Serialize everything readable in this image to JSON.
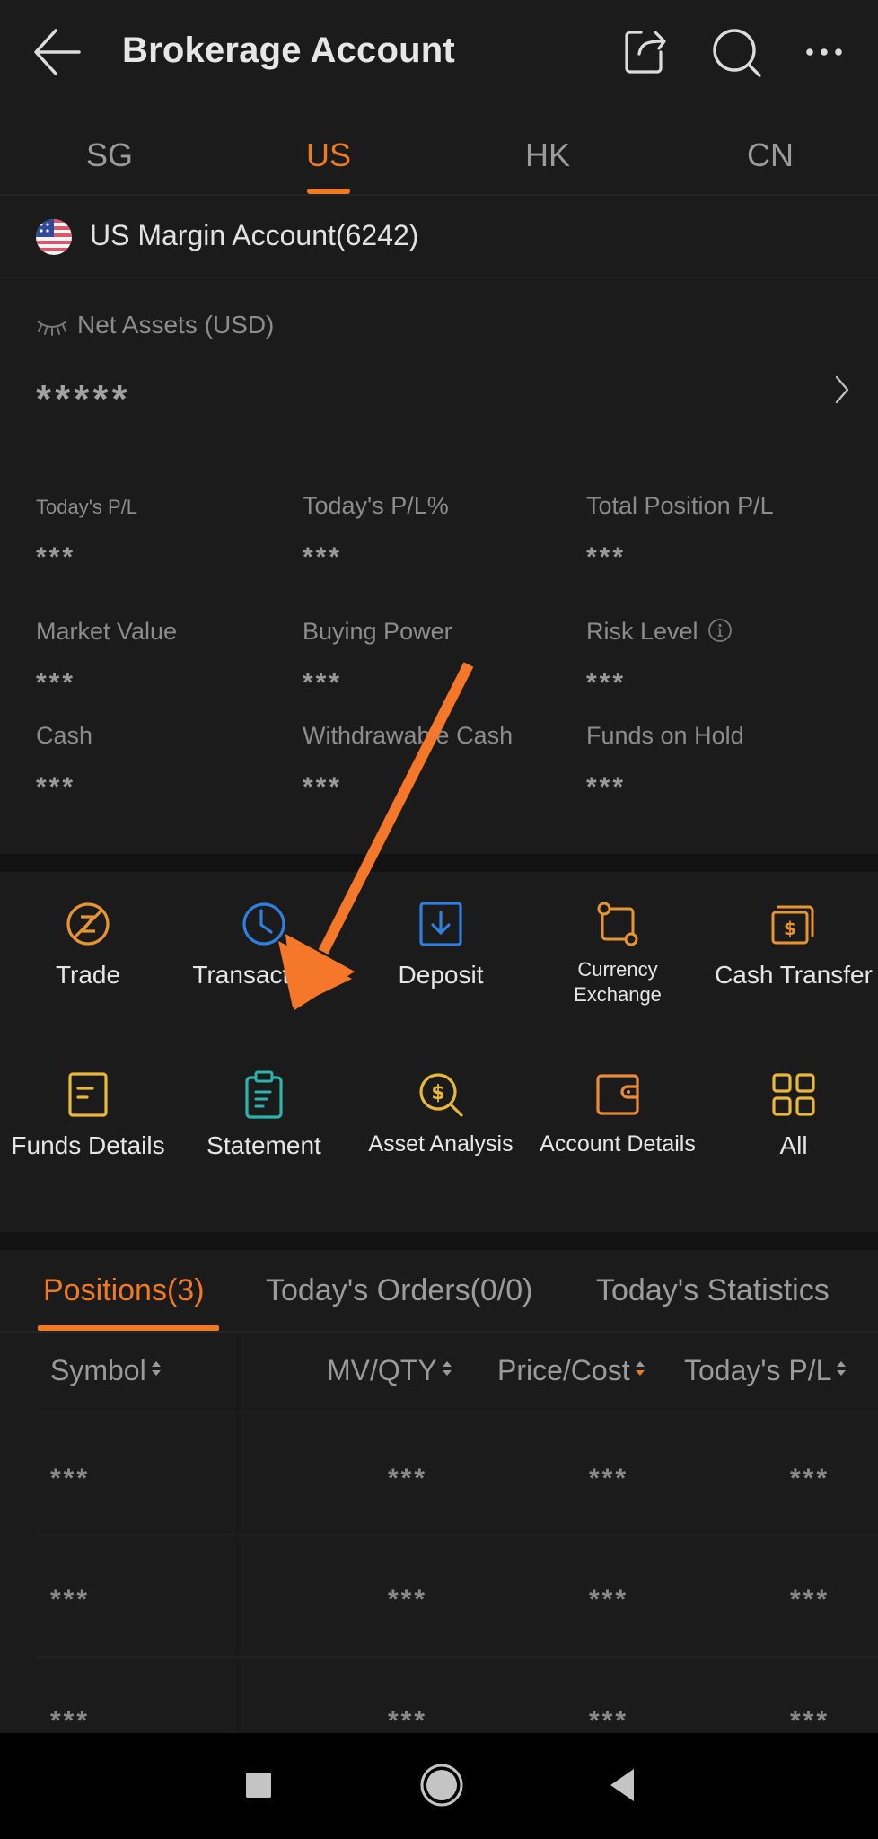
{
  "header": {
    "title": "Brokerage Account",
    "icons": [
      "back-arrow-icon",
      "share-icon",
      "search-icon",
      "more-icon"
    ]
  },
  "market_tabs": [
    {
      "label": "SG",
      "active": false
    },
    {
      "label": "US",
      "active": true
    },
    {
      "label": "HK",
      "active": false
    },
    {
      "label": "CN",
      "active": false
    }
  ],
  "account": {
    "name": "US Margin Account(6242)",
    "flag": "us-flag-icon"
  },
  "net_assets": {
    "label": "Net Assets (USD)",
    "value": "*****",
    "visibility_icon": "eye-closed-icon"
  },
  "metrics": [
    {
      "label": "Today's P/L",
      "value": "***"
    },
    {
      "label": "Today's P/L%",
      "value": "***"
    },
    {
      "label": "Total Position P/L",
      "value": "***"
    },
    {
      "label": "Market Value",
      "value": "***"
    },
    {
      "label": "Buying Power",
      "value": "***"
    },
    {
      "label": "Risk Level",
      "value": "***"
    },
    {
      "label": "Cash",
      "value": "***"
    },
    {
      "label": "Withdrawable Cash",
      "value": "***"
    },
    {
      "label": "Funds on Hold",
      "value": "***"
    }
  ],
  "shortcuts": [
    {
      "label": "Trade",
      "icon": "trade-icon"
    },
    {
      "label": "Transactions",
      "icon": "clock-icon"
    },
    {
      "label": "Deposit",
      "icon": "deposit-icon"
    },
    {
      "label": "Currency Exchange",
      "icon": "currency-exchange-icon"
    },
    {
      "label": "Cash Transfer",
      "icon": "cash-transfer-icon"
    },
    {
      "label": "Funds Details",
      "icon": "funds-details-icon"
    },
    {
      "label": "Statement",
      "icon": "statement-icon"
    },
    {
      "label": "Asset Analysis",
      "icon": "asset-analysis-icon"
    },
    {
      "label": "Account Details",
      "icon": "wallet-icon"
    },
    {
      "label": "All",
      "icon": "grid-icon"
    }
  ],
  "colors": {
    "accent": "#f07a23",
    "background": "#1b1b1b",
    "icon_orange": "#e8952f",
    "icon_blue": "#2e7fe0",
    "icon_teal": "#2bb3ad",
    "icon_yellow": "#e9b83a"
  },
  "position_tabs": [
    {
      "label": "Positions(3)",
      "active": true
    },
    {
      "label": "Today's Orders(0/0)",
      "active": false
    },
    {
      "label": "Today's Statistics",
      "active": false
    }
  ],
  "table": {
    "columns": [
      {
        "label": "Symbol",
        "sort": "none"
      },
      {
        "label": "MV/QTY",
        "sort": "none"
      },
      {
        "label": "Price/Cost",
        "sort": "descending"
      },
      {
        "label": "Today's P/L",
        "sort": "none"
      }
    ],
    "rows": [
      [
        "***",
        "***",
        "***",
        "***"
      ],
      [
        "***",
        "***",
        "***",
        "***"
      ],
      [
        "***",
        "***",
        "***",
        "***"
      ]
    ]
  },
  "navbar": {
    "buttons": [
      "recents-button",
      "home-button",
      "back-button"
    ]
  }
}
